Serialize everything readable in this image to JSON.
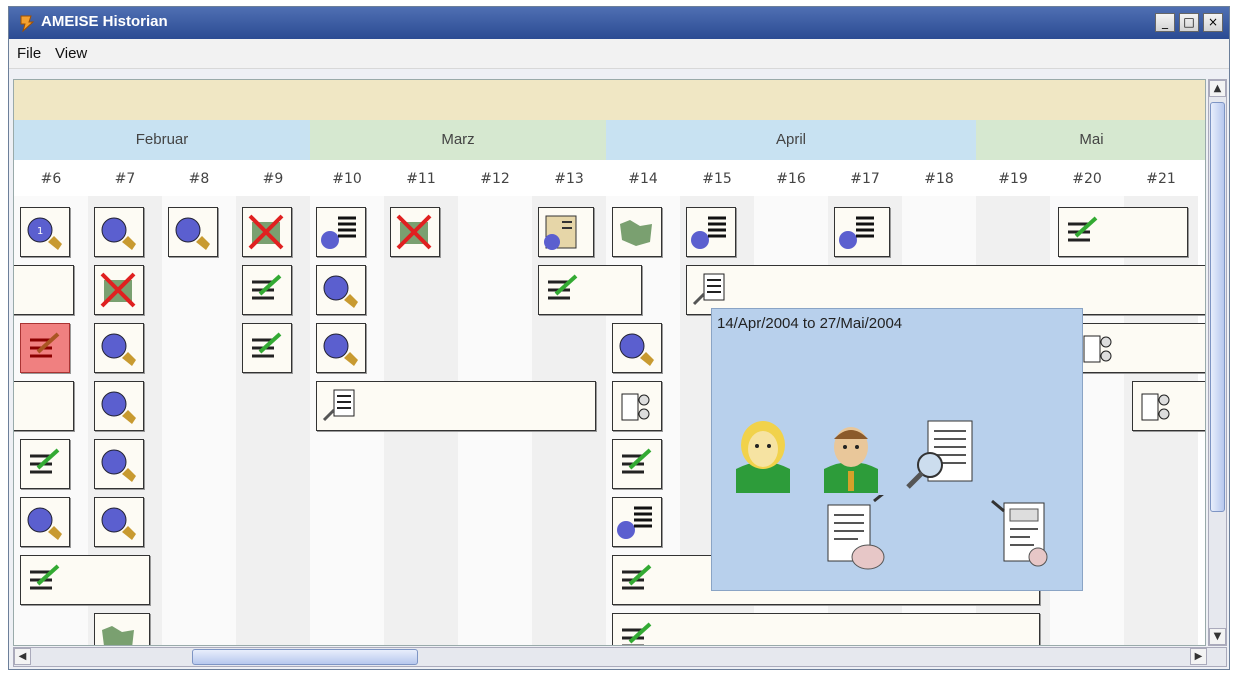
{
  "window": {
    "title": "AMEISE Historian",
    "min_label": "_",
    "max_label": "□",
    "close_label": "×"
  },
  "menu": [
    {
      "label": "File"
    },
    {
      "label": "View"
    }
  ],
  "months": [
    {
      "label": "Februar"
    },
    {
      "label": "Marz"
    },
    {
      "label": "April"
    },
    {
      "label": "Mai"
    }
  ],
  "weeks": [
    "#6",
    "#7",
    "#8",
    "#9",
    "#10",
    "#11",
    "#12",
    "#13",
    "#14",
    "#15",
    "#16",
    "#17",
    "#18",
    "#19",
    "#20",
    "#21"
  ],
  "popup": {
    "range_text": "14/Apr/2004 to 27/Mai/2004"
  },
  "colors": {
    "month_blue": "#c8e2f2",
    "month_green": "#d6e8d0",
    "top_band": "#f0e7c4",
    "popup_bg": "#b8d0ec",
    "alert_red": "#f08080"
  },
  "icons": {
    "clock_person": "clock-person-icon",
    "cancelled": "cancelled-x-icon",
    "document": "document-icon",
    "checklist": "checklist-icon",
    "map": "map-icon",
    "review": "review-doc-icon",
    "spec": "spec-doc-icon",
    "team": "team-icon"
  }
}
